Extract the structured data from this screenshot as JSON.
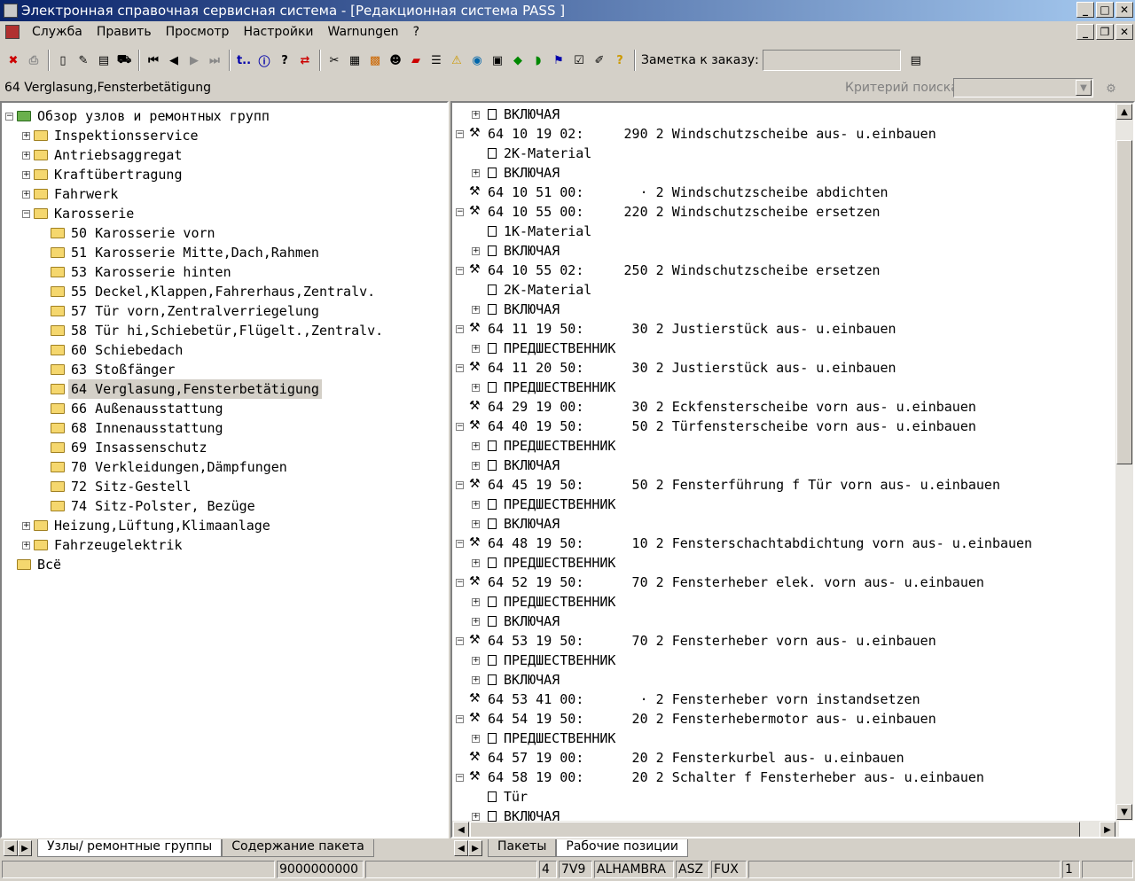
{
  "window": {
    "title": "Электронная справочная сервисная система - [Редакционная система PASS ]"
  },
  "menu": [
    "Служба",
    "Править",
    "Просмотр",
    "Настройки",
    "Warnungen",
    "?"
  ],
  "toolbar": {
    "note_label": "Заметка к заказу:",
    "note_value": ""
  },
  "path_text": "64 Verglasung,Fensterbetätigung",
  "search_label": "Критерий поиска:",
  "tree": {
    "root": "Обзор узлов и ремонтных групп",
    "top_items": [
      "Inspektionsservice",
      "Antriebsaggregat",
      "Kraftübertragung",
      "Fahrwerk",
      "Karosserie"
    ],
    "sub_items": [
      "50 Karosserie vorn",
      "51 Karosserie Mitte,Dach,Rahmen",
      "53 Karosserie hinten",
      "55 Deckel,Klappen,Fahrerhaus,Zentralv.",
      "57 Tür vorn,Zentralverriegelung",
      "58 Tür hi,Schiebetür,Flügelt.,Zentralv.",
      "60 Schiebedach",
      "63 Stoßfänger",
      "64 Verglasung,Fensterbetätigung",
      "66 Außenausstattung",
      "68 Innenausstattung",
      "69 Insassenschutz",
      "70 Verkleidungen,Dämpfungen",
      "72 Sitz-Gestell",
      "74 Sitz-Polster, Bezüge"
    ],
    "bottom_items": [
      "Heizung,Lüftung,Klimaanlage",
      "Fahrzeugelektrik"
    ],
    "all": "Всё"
  },
  "left_tabs": [
    "Узлы/ ремонтные группы",
    "Содержание пакета"
  ],
  "right_tabs": [
    "Пакеты",
    "Рабочие позиции"
  ],
  "positions": [
    {
      "k": "sub",
      "e": "+",
      "t": "ВКЛЮЧАЯ"
    },
    {
      "k": "op",
      "e": "-",
      "t": "64 10 19 02:     290 2 Windschutzscheibe aus- u.einbauen"
    },
    {
      "k": "note",
      "t": "2K-Material"
    },
    {
      "k": "sub",
      "e": "+",
      "t": "ВКЛЮЧАЯ"
    },
    {
      "k": "op",
      "e": "",
      "t": "64 10 51 00:       · 2 Windschutzscheibe abdichten"
    },
    {
      "k": "op",
      "e": "-",
      "t": "64 10 55 00:     220 2 Windschutzscheibe ersetzen"
    },
    {
      "k": "note",
      "t": "1K-Material"
    },
    {
      "k": "sub",
      "e": "+",
      "t": "ВКЛЮЧАЯ"
    },
    {
      "k": "op",
      "e": "-",
      "t": "64 10 55 02:     250 2 Windschutzscheibe ersetzen"
    },
    {
      "k": "note",
      "t": "2K-Material"
    },
    {
      "k": "sub",
      "e": "+",
      "t": "ВКЛЮЧАЯ"
    },
    {
      "k": "op",
      "e": "-",
      "t": "64 11 19 50:      30 2 Justierstück aus- u.einbauen"
    },
    {
      "k": "sub",
      "e": "+",
      "t": "ПРЕДШЕСТВЕННИК"
    },
    {
      "k": "op",
      "e": "-",
      "t": "64 11 20 50:      30 2 Justierstück aus- u.einbauen"
    },
    {
      "k": "sub",
      "e": "+",
      "t": "ПРЕДШЕСТВЕННИК"
    },
    {
      "k": "op",
      "e": "",
      "t": "64 29 19 00:      30 2 Eckfensterscheibe vorn aus- u.einbauen"
    },
    {
      "k": "op",
      "e": "-",
      "t": "64 40 19 50:      50 2 Türfensterscheibe vorn aus- u.einbauen"
    },
    {
      "k": "sub",
      "e": "+",
      "t": "ПРЕДШЕСТВЕННИК"
    },
    {
      "k": "sub",
      "e": "+",
      "t": "ВКЛЮЧАЯ"
    },
    {
      "k": "op",
      "e": "-",
      "t": "64 45 19 50:      50 2 Fensterführung f Tür vorn aus- u.einbauen"
    },
    {
      "k": "sub",
      "e": "+",
      "t": "ПРЕДШЕСТВЕННИК"
    },
    {
      "k": "sub",
      "e": "+",
      "t": "ВКЛЮЧАЯ"
    },
    {
      "k": "op",
      "e": "-",
      "t": "64 48 19 50:      10 2 Fensterschachtabdichtung vorn aus- u.einbauen"
    },
    {
      "k": "sub",
      "e": "+",
      "t": "ПРЕДШЕСТВЕННИК"
    },
    {
      "k": "op",
      "e": "-",
      "t": "64 52 19 50:      70 2 Fensterheber elek. vorn aus- u.einbauen"
    },
    {
      "k": "sub",
      "e": "+",
      "t": "ПРЕДШЕСТВЕННИК"
    },
    {
      "k": "sub",
      "e": "+",
      "t": "ВКЛЮЧАЯ"
    },
    {
      "k": "op",
      "e": "-",
      "t": "64 53 19 50:      70 2 Fensterheber vorn aus- u.einbauen"
    },
    {
      "k": "sub",
      "e": "+",
      "t": "ПРЕДШЕСТВЕННИК"
    },
    {
      "k": "sub",
      "e": "+",
      "t": "ВКЛЮЧАЯ"
    },
    {
      "k": "op",
      "e": "",
      "t": "64 53 41 00:       · 2 Fensterheber vorn instandsetzen"
    },
    {
      "k": "op",
      "e": "-",
      "t": "64 54 19 50:      20 2 Fensterhebermotor aus- u.einbauen"
    },
    {
      "k": "sub",
      "e": "+",
      "t": "ПРЕДШЕСТВЕННИК"
    },
    {
      "k": "op",
      "e": "",
      "t": "64 57 19 00:      20 2 Fensterkurbel aus- u.einbauen"
    },
    {
      "k": "op",
      "e": "-",
      "t": "64 58 19 00:      20 2 Schalter f Fensterheber aus- u.einbauen"
    },
    {
      "k": "note",
      "t": "Tür"
    },
    {
      "k": "sub",
      "e": "+",
      "t": "ВКЛЮЧАЯ"
    }
  ],
  "status": {
    "order": "9000000000",
    "c1": "4",
    "c2": "7V9",
    "c3": "ALHAMBRA",
    "c4": "ASZ",
    "c5": "FUX",
    "page": "1"
  }
}
